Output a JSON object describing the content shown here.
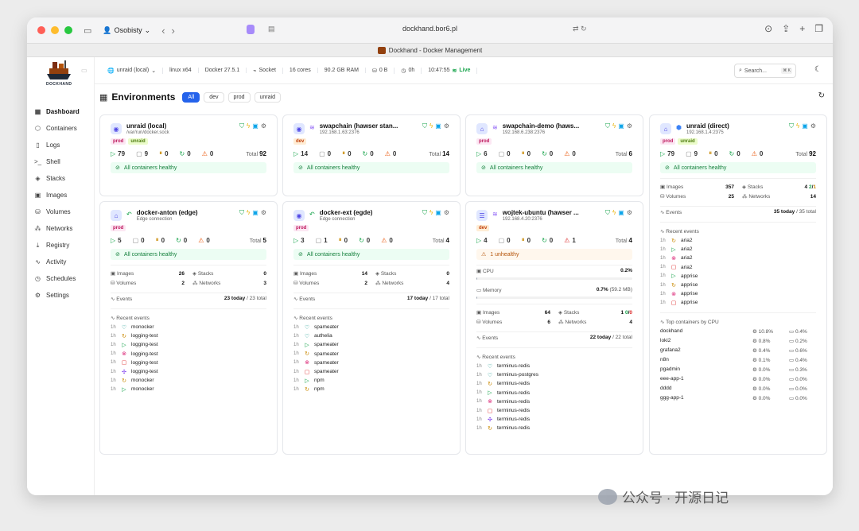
{
  "browser": {
    "profile": "Osobisty",
    "url": "dockhand.bor6.pl",
    "tab_title": "Dockhand - Docker Management"
  },
  "logo": {
    "text": "DOCKHAND"
  },
  "sidebar": {
    "items": [
      {
        "label": "Dashboard",
        "icon": "grid-icon",
        "active": true
      },
      {
        "label": "Containers",
        "icon": "box-icon"
      },
      {
        "label": "Logs",
        "icon": "file-icon"
      },
      {
        "label": "Shell",
        "icon": "terminal-icon"
      },
      {
        "label": "Stacks",
        "icon": "layers-icon"
      },
      {
        "label": "Images",
        "icon": "image-icon"
      },
      {
        "label": "Volumes",
        "icon": "database-icon"
      },
      {
        "label": "Networks",
        "icon": "network-icon"
      },
      {
        "label": "Registry",
        "icon": "download-icon"
      },
      {
        "label": "Activity",
        "icon": "activity-icon"
      },
      {
        "label": "Schedules",
        "icon": "clock-icon"
      },
      {
        "label": "Settings",
        "icon": "gear-icon"
      }
    ]
  },
  "header": {
    "env_select": "unraid (local)",
    "os": "linux x64",
    "docker": "Docker 27.5.1",
    "conn": "Socket",
    "cores": "16 cores",
    "ram": "90.2 GB RAM",
    "disk": "0 B",
    "uptime": "0h",
    "time": "10:47:55",
    "live": "Live",
    "search_placeholder": "Search...",
    "search_kbd": "⌘ K"
  },
  "page": {
    "title": "Environments",
    "filters": [
      "All",
      "dev",
      "prod",
      "unraid"
    ]
  },
  "cards": {
    "c1": {
      "name": "unraid (local)",
      "addr": "/var/run/docker.sock",
      "tags": [
        "prod",
        "unraid"
      ],
      "running": "79",
      "stopped": "9",
      "paused": "0",
      "restarting": "0",
      "unhealthy": "0",
      "total_label": "Total",
      "total": "92",
      "banner": "All containers healthy"
    },
    "c2": {
      "name": "swapchain (hawser stan...",
      "addr": "192.168.1.63:2376",
      "tags": [
        "dev"
      ],
      "running": "14",
      "stopped": "0",
      "paused": "0",
      "restarting": "0",
      "unhealthy": "0",
      "total_label": "Total",
      "total": "14",
      "banner": "All containers healthy"
    },
    "c3": {
      "name": "swapchain-demo (haws...",
      "addr": "192.168.6.238:2376",
      "tags": [
        "prod"
      ],
      "running": "6",
      "stopped": "0",
      "paused": "0",
      "restarting": "0",
      "unhealthy": "0",
      "total_label": "Total",
      "total": "6",
      "banner": "All containers healthy"
    },
    "c4": {
      "name": "unraid (direct)",
      "addr": "192.168.1.4:2375",
      "tags": [
        "prod",
        "unraid"
      ],
      "running": "79",
      "stopped": "9",
      "paused": "0",
      "restarting": "0",
      "unhealthy": "0",
      "total_label": "Total",
      "total": "92",
      "banner": "All containers healthy",
      "images_label": "Images",
      "images": "357",
      "stacks_label": "Stacks",
      "stacks_a": "4",
      "stacks_b": "2",
      "stacks_c": "1",
      "volumes_label": "Volumes",
      "volumes": "25",
      "networks_label": "Networks",
      "networks": "14",
      "events_label": "Events",
      "events_today": "35 today",
      "events_total": "/ 35 total",
      "recent_label": "Recent events",
      "events": [
        {
          "t": "1h",
          "icon": "restart",
          "name": "aria2"
        },
        {
          "t": "1h",
          "icon": "start",
          "name": "aria2"
        },
        {
          "t": "1h",
          "icon": "kill",
          "name": "aria2"
        },
        {
          "t": "1h",
          "icon": "stop",
          "name": "aria2"
        },
        {
          "t": "1h",
          "icon": "start",
          "name": "apprise"
        },
        {
          "t": "1h",
          "icon": "restart",
          "name": "apprise"
        },
        {
          "t": "1h",
          "icon": "kill",
          "name": "apprise"
        },
        {
          "t": "1h",
          "icon": "stop",
          "name": "apprise"
        }
      ],
      "cpu_label": "Top containers by CPU",
      "cpu": [
        {
          "name": "dockhand",
          "cpu": "10.8%",
          "mem": "0.4%"
        },
        {
          "name": "loki2",
          "cpu": "0.8%",
          "mem": "0.2%"
        },
        {
          "name": "grafana2",
          "cpu": "0.4%",
          "mem": "0.6%"
        },
        {
          "name": "n8n",
          "cpu": "0.1%",
          "mem": "0.4%"
        },
        {
          "name": "pgadmin",
          "cpu": "0.0%",
          "mem": "0.3%"
        },
        {
          "name": "eee-app-1",
          "cpu": "0.0%",
          "mem": "0.0%"
        },
        {
          "name": "dddd",
          "cpu": "0.0%",
          "mem": "0.0%"
        },
        {
          "name": "ggg-app-1",
          "cpu": "0.0%",
          "mem": "0.0%"
        }
      ]
    },
    "c5": {
      "name": "docker-anton (edge)",
      "addr": "Edge connection",
      "tags": [
        "prod"
      ],
      "running": "5",
      "stopped": "0",
      "paused": "0",
      "restarting": "0",
      "unhealthy": "0",
      "total_label": "Total",
      "total": "5",
      "banner": "All containers healthy",
      "images_label": "Images",
      "images": "26",
      "stacks_label": "Stacks",
      "stacks": "0",
      "volumes_label": "Volumes",
      "volumes": "2",
      "networks_label": "Networks",
      "networks": "3",
      "events_label": "Events",
      "events_today": "23 today",
      "events_total": "/ 23 total",
      "recent_label": "Recent events",
      "events": [
        {
          "t": "1h",
          "icon": "health",
          "name": "monocker"
        },
        {
          "t": "1h",
          "icon": "restart",
          "name": "logging-test"
        },
        {
          "t": "1h",
          "icon": "start",
          "name": "logging-test"
        },
        {
          "t": "1h",
          "icon": "kill",
          "name": "logging-test"
        },
        {
          "t": "1h",
          "icon": "stop",
          "name": "logging-test"
        },
        {
          "t": "1h",
          "icon": "create",
          "name": "logging-test"
        },
        {
          "t": "1h",
          "icon": "restart",
          "name": "monocker"
        },
        {
          "t": "1h",
          "icon": "start",
          "name": "monocker"
        }
      ]
    },
    "c6": {
      "name": "docker-ext (egde)",
      "addr": "Edge connection",
      "tags": [
        "prod"
      ],
      "running": "3",
      "stopped": "1",
      "paused": "0",
      "restarting": "0",
      "unhealthy": "0",
      "total_label": "Total",
      "total": "4",
      "banner": "All containers healthy",
      "images_label": "Images",
      "images": "14",
      "stacks_label": "Stacks",
      "stacks": "0",
      "volumes_label": "Volumes",
      "volumes": "2",
      "networks_label": "Networks",
      "networks": "4",
      "events_label": "Events",
      "events_today": "17 today",
      "events_total": "/ 17 total",
      "recent_label": "Recent events",
      "events": [
        {
          "t": "1h",
          "icon": "health",
          "name": "spameater"
        },
        {
          "t": "1h",
          "icon": "health",
          "name": "authelia"
        },
        {
          "t": "1h",
          "icon": "start",
          "name": "spameater"
        },
        {
          "t": "1h",
          "icon": "restart",
          "name": "spameater"
        },
        {
          "t": "1h",
          "icon": "kill",
          "name": "spameater"
        },
        {
          "t": "1h",
          "icon": "stop",
          "name": "spameater"
        },
        {
          "t": "1h",
          "icon": "start",
          "name": "npm"
        },
        {
          "t": "1h",
          "icon": "restart",
          "name": "npm"
        }
      ]
    },
    "c7": {
      "name": "wojtek-ubuntu (hawser ...",
      "addr": "192.168.4.20:2376",
      "tags": [
        "dev"
      ],
      "running": "4",
      "stopped": "0",
      "paused": "0",
      "restarting": "0",
      "unhealthy": "1",
      "total_label": "Total",
      "total": "4",
      "banner": "1 unhealthy",
      "cpu_label": "CPU",
      "cpu": "0.2%",
      "cpu_fraction": 0.002,
      "mem_label": "Memory",
      "mem": "0.7%",
      "mem_detail": "(59.2 MB)",
      "mem_fraction": 0.007,
      "images_label": "Images",
      "images": "64",
      "stacks_label": "Stacks",
      "stacks_a": "1",
      "stacks_b": "0",
      "stacks_c": "0",
      "volumes_label": "Volumes",
      "volumes": "6",
      "networks_label": "Networks",
      "networks": "4",
      "events_label": "Events",
      "events_today": "22 today",
      "events_total": "/ 22 total",
      "recent_label": "Recent events",
      "events": [
        {
          "t": "1h",
          "icon": "health",
          "name": "terminus-redis"
        },
        {
          "t": "1h",
          "icon": "health",
          "name": "terminus-postgres"
        },
        {
          "t": "1h",
          "icon": "restart",
          "name": "terminus-redis"
        },
        {
          "t": "1h",
          "icon": "start",
          "name": "terminus-redis"
        },
        {
          "t": "1h",
          "icon": "kill",
          "name": "terminus-redis"
        },
        {
          "t": "1h",
          "icon": "stop",
          "name": "terminus-redis"
        },
        {
          "t": "1h",
          "icon": "create",
          "name": "terminus-redis"
        },
        {
          "t": "1h",
          "icon": "restart",
          "name": "terminus-redis"
        }
      ]
    }
  },
  "watermark": "公众号 · 开源日记",
  "colors": {
    "accent": "#2563eb",
    "healthy": "#15803d",
    "warning": "#b45309",
    "live": "#16a34a"
  }
}
